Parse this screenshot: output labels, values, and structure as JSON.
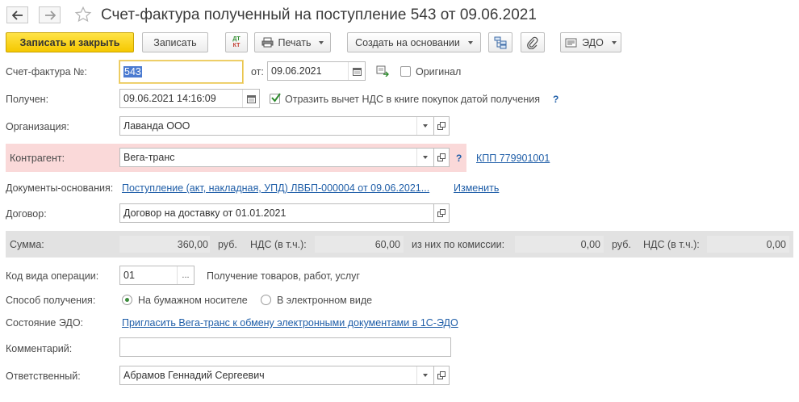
{
  "window": {
    "title": "Счет-фактура полученный на поступление 543 от 09.06.2021"
  },
  "toolbar": {
    "save_close": "Записать и закрыть",
    "save": "Записать",
    "dt_kt_top": "ДТ",
    "dt_kt_bottom": "КТ",
    "print": "Печать",
    "create_based": "Создать на основании",
    "edo": "ЭДО"
  },
  "form": {
    "invoice_label": "Счет-фактура №:",
    "invoice_number": "543",
    "from_label": "от:",
    "invoice_date": "09.06.2021",
    "original_label": "Оригинал",
    "received_label": "Получен:",
    "received_datetime": "09.06.2021 14:16:09",
    "vat_checkbox_label": "Отразить вычет НДС в книге покупок датой получения",
    "help_mark": "?",
    "organization_label": "Организация:",
    "organization_value": "Лаванда ООО",
    "counterparty_label": "Контрагент:",
    "counterparty_value": "Вега-транс",
    "kpp_link": "КПП 779901001",
    "base_docs_label": "Документы-основания:",
    "base_docs_link": "Поступление (акт, накладная, УПД) ЛВБП-000004 от 09.06.2021...",
    "change_link": "Изменить",
    "contract_label": "Договор:",
    "contract_value": "Договор на доставку от 01.01.2021",
    "operation_code_label": "Код вида операции:",
    "operation_code_value": "01",
    "operation_code_button": "...",
    "operation_code_desc": "Получение товаров, работ, услуг",
    "receipt_method_label": "Способ получения:",
    "receipt_paper": "На бумажном носителе",
    "receipt_electronic": "В электронном виде",
    "edo_state_label": "Состояние ЭДО:",
    "edo_invite_link": "Пригласить Вега-транс к обмену электронными документами в 1С-ЭДО",
    "comment_label": "Комментарий:",
    "comment_value": "",
    "responsible_label": "Ответственный:",
    "responsible_value": "Абрамов Геннадий Сергеевич"
  },
  "summary": {
    "sum_label": "Сумма:",
    "sum_value": "360,00",
    "currency1": "руб.",
    "vat_label1": "НДС (в т.ч.):",
    "vat_value1": "60,00",
    "commission_label": "из них по комиссии:",
    "commission_value": "0,00",
    "currency2": "руб.",
    "vat_label2": "НДС (в т.ч.):",
    "vat_value2": "0,00"
  },
  "state": {
    "original_checked": false,
    "vat_checked": true,
    "receipt_method": "paper"
  },
  "colors": {
    "primary_button": "#f5c800",
    "highlight_row": "#fad9d9",
    "link": "#1f5ea8",
    "summary_band": "#e2e2e2"
  }
}
